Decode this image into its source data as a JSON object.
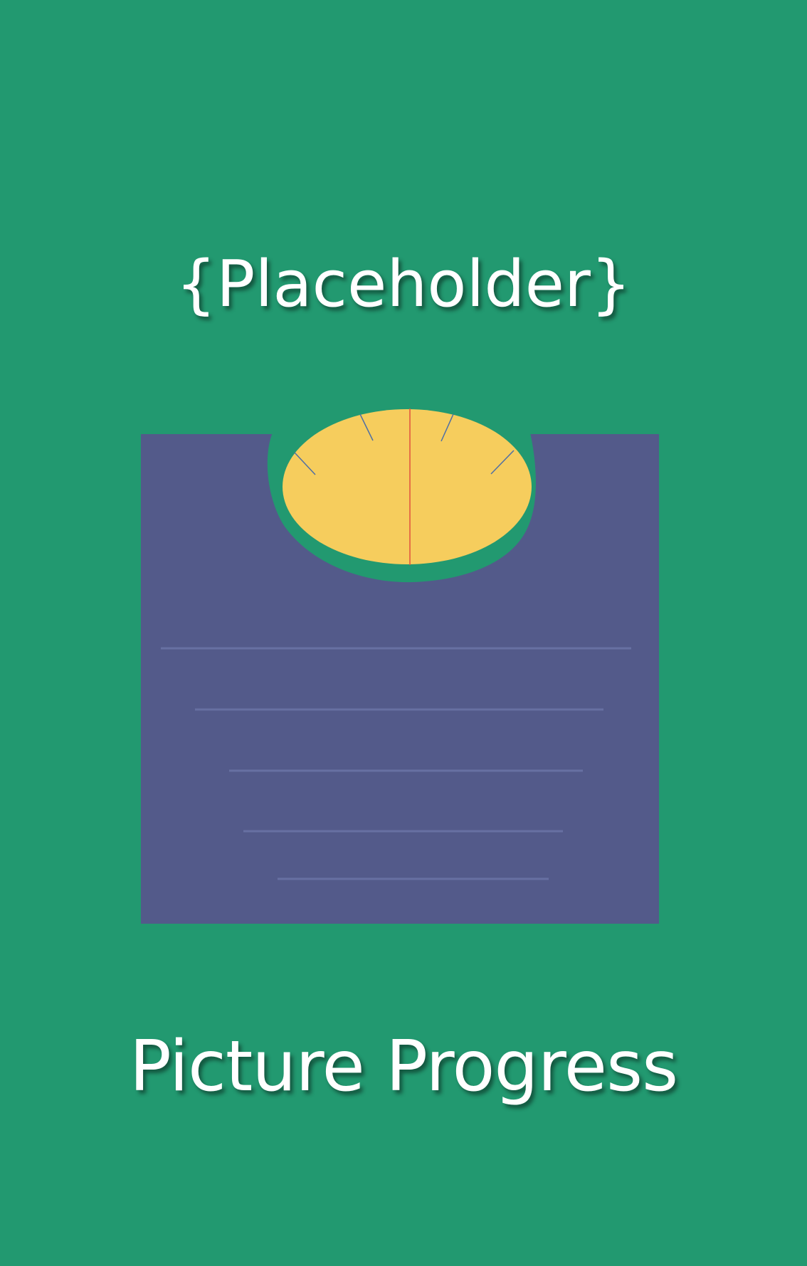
{
  "screen": {
    "placeholder_text": "{Placeholder}",
    "title": "Picture Progress"
  },
  "scale_illustration": {
    "icon": "bathroom-scale-icon",
    "colors": {
      "background": "#229970",
      "scale_body": "#535a8a",
      "dial_face": "#f6cd5d",
      "needle": "#e0523f",
      "tick": "#4f6fa4",
      "platform_lines": "#6770a2",
      "text": "#ffffff"
    }
  }
}
